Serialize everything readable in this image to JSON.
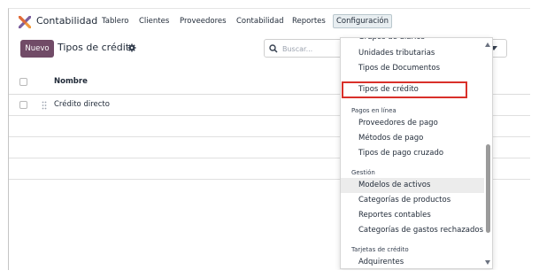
{
  "navbar": {
    "app_icon": "odoo-cross-icon",
    "app_name": "Contabilidad",
    "menus": [
      "Tablero",
      "Clientes",
      "Proveedores",
      "Contabilidad",
      "Reportes",
      "Configuración"
    ],
    "active_menu": "Configuración"
  },
  "control_panel": {
    "new_label": "Nuevo",
    "title": "Tipos de crédito",
    "gear_icon": "gear-icon",
    "search_placeholder": "Buscar...",
    "search_icon": "search-icon"
  },
  "list": {
    "column_header": "Nombre",
    "rows": [
      "Crédito directo"
    ]
  },
  "dropdown": {
    "items_top": [
      "Grupos de diarios",
      "Unidades tributarias",
      "Tipos de Documentos",
      "Tipos de crédito"
    ],
    "highlighted_item": "Tipos de crédito",
    "sections": [
      {
        "header": "Pagos en línea",
        "items": [
          "Proveedores de pago",
          "Métodos de pago",
          "Tipos de pago cruzado"
        ]
      },
      {
        "header": "Gestión",
        "items": [
          "Modelos de activos",
          "Categorías de productos",
          "Reportes contables",
          "Categorías de gastos rechazados"
        ]
      },
      {
        "header": "Tarjetas de crédito",
        "items": [
          "Adquirentes"
        ]
      }
    ],
    "hovered_item": "Modelos de activos"
  },
  "colors": {
    "brand": "#714b67",
    "highlight_border": "#d9302a"
  }
}
